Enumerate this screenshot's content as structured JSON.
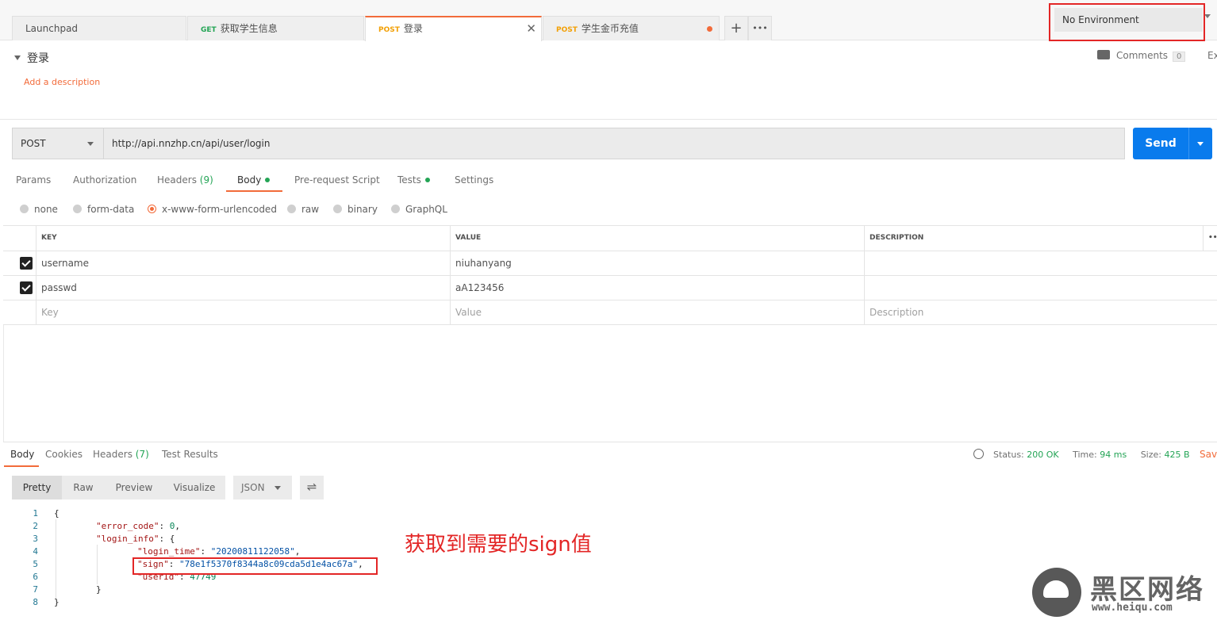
{
  "tabs": [
    {
      "method": "",
      "label": "Launchpad"
    },
    {
      "method": "GET",
      "label": "获取学生信息"
    },
    {
      "method": "POST",
      "label": "登录"
    },
    {
      "method": "POST",
      "label": "学生金币充值"
    }
  ],
  "tab_icons": {
    "add": "+",
    "more": "•••",
    "close": "✕"
  },
  "environment": {
    "selected": "No Environment"
  },
  "request": {
    "title": "登录",
    "add_description": "Add a description",
    "comments_label": "Comments",
    "comments_count": "0",
    "export_label": "Ex",
    "method": "POST",
    "url": "http://api.nnzhp.cn/api/user/login",
    "send_label": "Send"
  },
  "request_tabs": {
    "params": "Params",
    "authorization": "Authorization",
    "headers": "Headers",
    "headers_count": "(9)",
    "body": "Body",
    "prerequest": "Pre-request Script",
    "tests": "Tests",
    "settings": "Settings"
  },
  "body_types": {
    "none": "none",
    "form_data": "form-data",
    "urlencoded": "x-www-form-urlencoded",
    "raw": "raw",
    "binary": "binary",
    "graphql": "GraphQL"
  },
  "params_table": {
    "headers": {
      "key": "KEY",
      "value": "VALUE",
      "description": "DESCRIPTION"
    },
    "more": "••",
    "rows": [
      {
        "key": "username",
        "value": "niuhanyang",
        "description": ""
      },
      {
        "key": "passwd",
        "value": "aA123456",
        "description": ""
      }
    ],
    "placeholders": {
      "key": "Key",
      "value": "Value",
      "description": "Description"
    }
  },
  "response_tabs": {
    "body": "Body",
    "cookies": "Cookies",
    "headers": "Headers",
    "headers_count": "(7)",
    "test_results": "Test Results"
  },
  "status": {
    "status_label": "Status:",
    "status_value": "200 OK",
    "time_label": "Time:",
    "time_value": "94 ms",
    "size_label": "Size:",
    "size_value": "425 B",
    "save_label": "Save"
  },
  "view_modes": {
    "pretty": "Pretty",
    "raw": "Raw",
    "preview": "Preview",
    "visualize": "Visualize",
    "format": "JSON",
    "wrap_icon": "⇌"
  },
  "code": {
    "line_numbers": [
      "1",
      "2",
      "3",
      "4",
      "5",
      "6",
      "7",
      "8"
    ],
    "l1": "{",
    "l2_key": "\"error_code\"",
    "l2_val": "0",
    "l3_key": "\"login_info\"",
    "l3_rest": ": {",
    "l4_key": "\"login_time\"",
    "l4_val": "\"20200811122058\"",
    "l5_key": "\"sign\"",
    "l5_val": "\"78e1f5370f8344a8c09cda5d1e4ac67a\"",
    "l6_key": "\"userId\"",
    "l6_val": "47749",
    "l7": "}",
    "l8": "}"
  },
  "annotation": "获取到需要的sign值",
  "watermark": {
    "title": "黑区网络",
    "url": "www.heiqu.com"
  },
  "colors": {
    "accent": "#f26b3a",
    "send": "#097bed",
    "success": "#23a455",
    "highlight": "#e32626"
  }
}
